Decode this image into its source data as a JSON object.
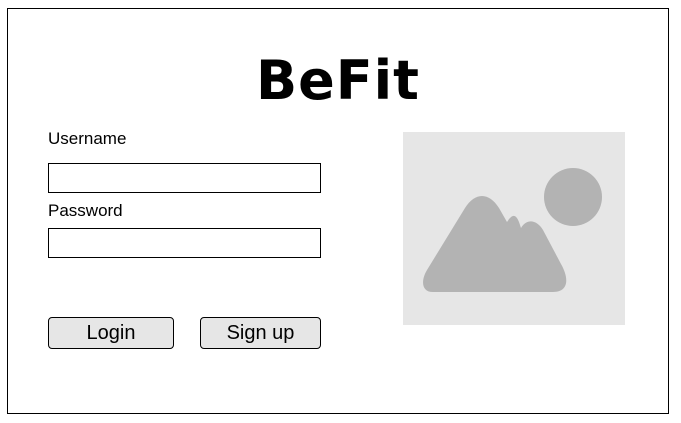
{
  "header": {
    "logo_text": "BeFit"
  },
  "login_form": {
    "username_label": "Username",
    "username_value": "",
    "password_label": "Password",
    "password_value": "",
    "login_button": "Login",
    "signup_button": "Sign up"
  },
  "image_placeholder": {
    "icon": "image-icon",
    "background_color": "#e6e6e6",
    "shape_color": "#b3b3b3"
  }
}
